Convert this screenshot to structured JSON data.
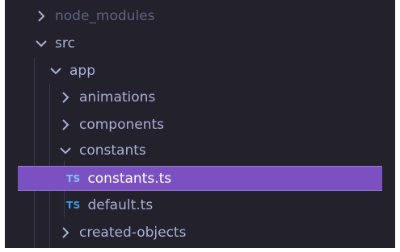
{
  "tree": {
    "items": [
      {
        "label": "node_modules",
        "type": "folder",
        "expanded": false,
        "icon": "chevron-right-icon"
      },
      {
        "label": "src",
        "type": "folder",
        "expanded": true,
        "icon": "chevron-down-icon"
      },
      {
        "label": "app",
        "type": "folder",
        "expanded": true,
        "icon": "chevron-down-icon"
      },
      {
        "label": "animations",
        "type": "folder",
        "expanded": false,
        "icon": "chevron-right-icon"
      },
      {
        "label": "components",
        "type": "folder",
        "expanded": false,
        "icon": "chevron-right-icon"
      },
      {
        "label": "constants",
        "type": "folder",
        "expanded": true,
        "icon": "chevron-down-icon"
      },
      {
        "label": "constants.ts",
        "type": "file",
        "badge": "TS",
        "selected": true
      },
      {
        "label": "default.ts",
        "type": "file",
        "badge": "TS",
        "selected": false
      },
      {
        "label": "created-objects",
        "type": "folder",
        "expanded": false,
        "icon": "chevron-right-icon"
      }
    ]
  },
  "colors": {
    "background": "#22212c",
    "selection": "#7b51c2",
    "text": "#a9b1d6",
    "ts_badge": "#3f9ee5"
  }
}
